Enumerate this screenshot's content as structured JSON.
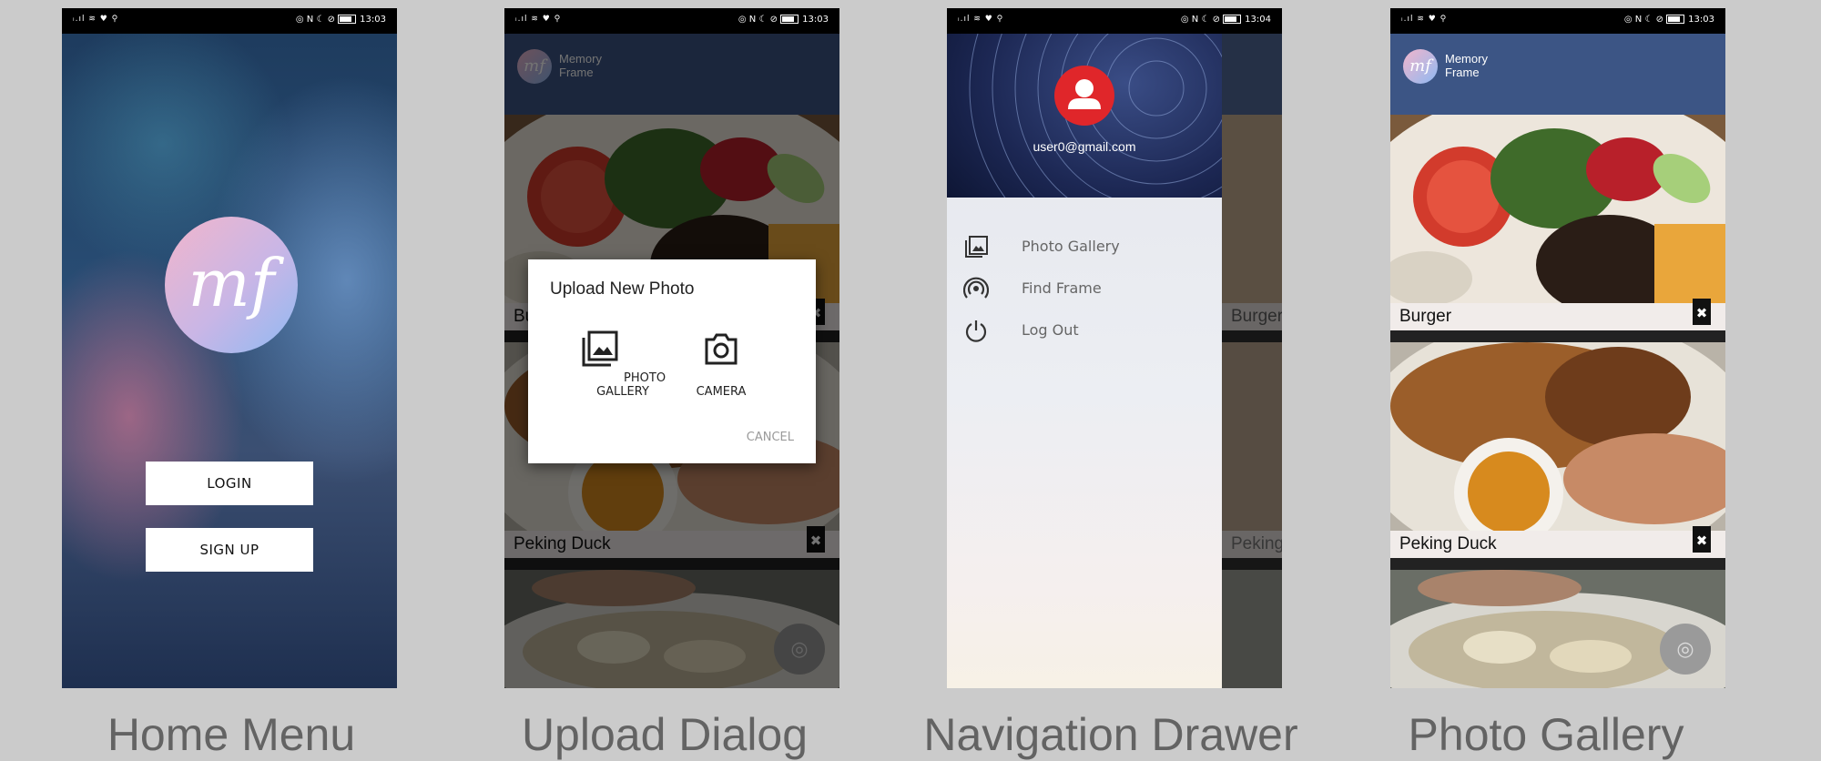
{
  "status": {
    "left_icons": "ᵢ.ıl ≋ ♥ ⚲",
    "right_icons": "◎ N ☾ ⊘",
    "time_home": "13:03",
    "time_dialog": "13:03",
    "time_drawer": "13:04",
    "time_gallery": "13:03"
  },
  "app": {
    "logo_text": "mf",
    "title": "Memory Frame"
  },
  "home": {
    "login_label": "LOGIN",
    "signup_label": "SIGN UP"
  },
  "dialog": {
    "title": "Upload New Photo",
    "option_gallery": "PHOTO GALLERY",
    "option_camera": "CAMERA",
    "cancel_label": "CANCEL",
    "partial_caption": "Bu"
  },
  "drawer": {
    "email": "user0@gmail.com",
    "items": [
      {
        "label": "Photo Gallery",
        "icon": "gallery-icon"
      },
      {
        "label": "Find Frame",
        "icon": "signal-icon"
      },
      {
        "label": "Log Out",
        "icon": "power-icon"
      }
    ],
    "partial_captions": [
      "Burger",
      "Peking"
    ]
  },
  "gallery": {
    "photos": [
      {
        "caption": "Burger"
      },
      {
        "caption": "Peking Duck"
      }
    ]
  },
  "captions": [
    "Home Menu",
    "Upload Dialog",
    "Navigation Drawer",
    "Photo Gallery"
  ]
}
